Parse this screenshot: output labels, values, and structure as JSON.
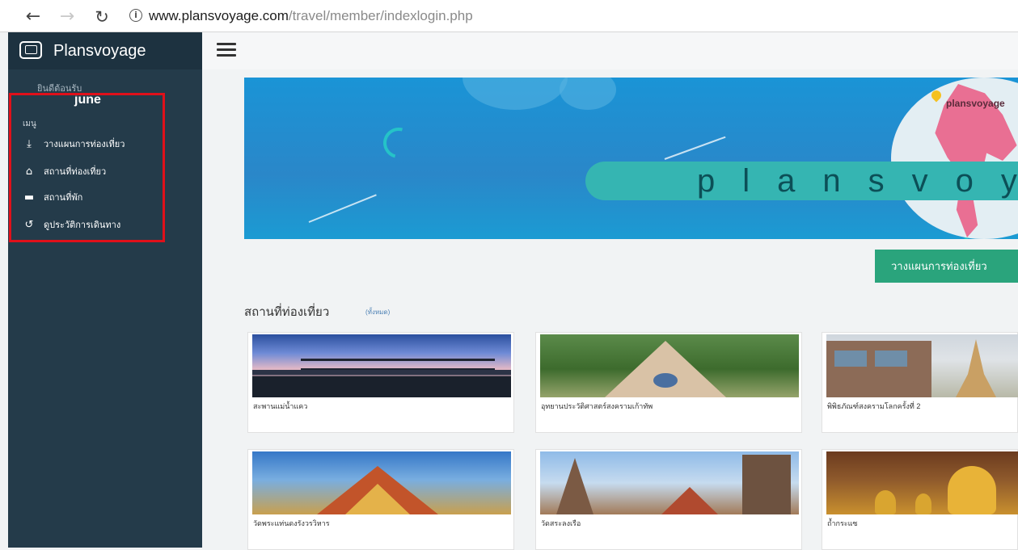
{
  "browser": {
    "url_host": "www.plansvoyage.com",
    "url_path": "/travel/member/indexlogin.php"
  },
  "sidebar": {
    "brand": "Plansvoyage",
    "welcome": "ยินดีต้อนรับ",
    "username": "june",
    "menu_header": "เมนู",
    "items": [
      {
        "label": "วางแผนการท่องเที่ยว",
        "icon": "download-icon"
      },
      {
        "label": "สถานที่ท่องเที่ยว",
        "icon": "home-icon"
      },
      {
        "label": "สถานที่พัก",
        "icon": "bed-icon"
      },
      {
        "label": "ดูประวัติการเดินทาง",
        "icon": "history-icon"
      }
    ]
  },
  "banner": {
    "word": "plansvoyage",
    "map_label": "plansvoyage"
  },
  "main": {
    "plan_button": "วางแผนการท่องเที่ยว",
    "section_title": "สถานที่ท่องเที่ยว",
    "section_more": "(ทั้งหมด)",
    "cards": [
      {
        "caption": "สะพานแม่น้ำแคว"
      },
      {
        "caption": "อุทยานประวัติศาสตร์สงครามเก้าทัพ"
      },
      {
        "caption": "พิพิธภัณฑ์สงครามโลกครั้งที่ 2"
      },
      {
        "caption": "วัดพระแท่นดงรังวรวิหาร"
      },
      {
        "caption": "วัดสระลงเรือ"
      },
      {
        "caption": "ถ้ำกระแซ"
      }
    ]
  },
  "colors": {
    "sidebar": "#243b4a",
    "highlight": "#e0101a",
    "plan_button": "#2aa47c",
    "banner": "#1a94d6"
  }
}
